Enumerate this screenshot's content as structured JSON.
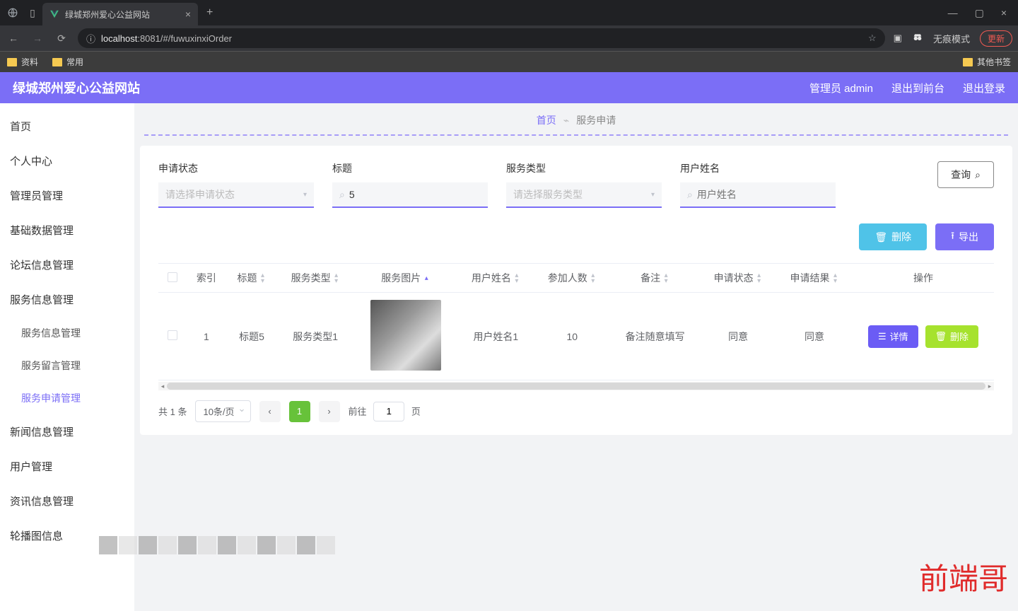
{
  "browser": {
    "tab_title": "绿城郑州爱心公益网站",
    "url_prefix": "localhost",
    "url_suffix": ":8081/#/fuwuxinxiOrder",
    "bookmarks": [
      "资料",
      "常用"
    ],
    "other_bookmarks": "其他书签",
    "incognito": "无痕模式",
    "update": "更新"
  },
  "app": {
    "title": "绿城郑州爱心公益网站",
    "header_user": "管理员 admin",
    "header_to_front": "退出到前台",
    "header_logout": "退出登录"
  },
  "sidebar": {
    "items": [
      {
        "label": "首页"
      },
      {
        "label": "个人中心"
      },
      {
        "label": "管理员管理"
      },
      {
        "label": "基础数据管理"
      },
      {
        "label": "论坛信息管理"
      },
      {
        "label": "服务信息管理",
        "children": [
          {
            "label": "服务信息管理"
          },
          {
            "label": "服务留言管理"
          },
          {
            "label": "服务申请管理",
            "active": true
          }
        ]
      },
      {
        "label": "新闻信息管理"
      },
      {
        "label": "用户管理"
      },
      {
        "label": "资讯信息管理"
      },
      {
        "label": "轮播图信息"
      }
    ]
  },
  "breadcrumb": {
    "home": "首页",
    "current": "服务申请"
  },
  "filters": {
    "status": {
      "label": "申请状态",
      "placeholder": "请选择申请状态"
    },
    "title": {
      "label": "标题",
      "value": "5"
    },
    "type": {
      "label": "服务类型",
      "placeholder": "请选择服务类型"
    },
    "user": {
      "label": "用户姓名",
      "placeholder": "用户姓名"
    },
    "query_btn": "查询"
  },
  "actions": {
    "batch_delete": "删除",
    "export": "导出"
  },
  "table": {
    "headers": [
      "",
      "索引",
      "标题",
      "服务类型",
      "服务图片",
      "用户姓名",
      "参加人数",
      "备注",
      "申请状态",
      "申请结果",
      "操作"
    ],
    "row": {
      "index": "1",
      "title": "标题5",
      "type": "服务类型1",
      "user": "用户姓名1",
      "count": "10",
      "remark": "备注随意填写",
      "status": "同意",
      "result": "同意",
      "detail_btn": "详情",
      "delete_btn": "删除"
    }
  },
  "pagination": {
    "total_text": "共 1 条",
    "page_size": "10条/页",
    "current": "1",
    "goto_prefix": "前往",
    "goto_value": "1",
    "goto_suffix": "页"
  },
  "watermark": "前端哥"
}
